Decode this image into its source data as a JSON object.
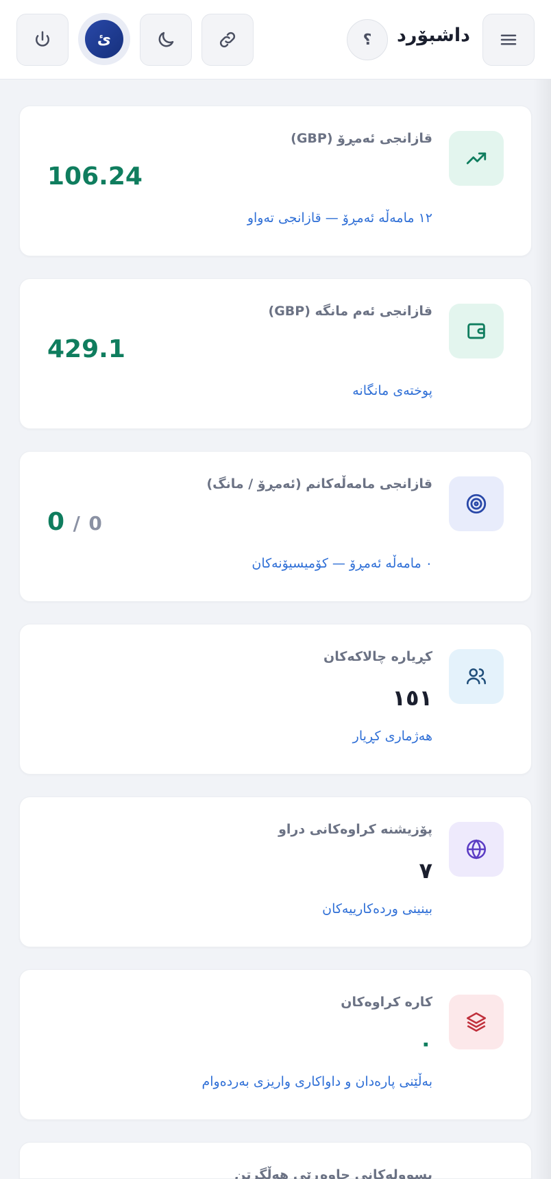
{
  "header": {
    "title": "داشبۆرد",
    "help_label": "؟",
    "avatar_letter": "ئ",
    "icons": [
      "menu-icon",
      "link-icon",
      "moon-icon",
      "power-icon"
    ]
  },
  "cards": [
    {
      "title": "قازانجی ئەمڕۆ (GBP)",
      "value": "106.24",
      "link": "١٢ مامەڵە ئەمڕۆ — قازانجی تەواو",
      "icon": "trending-up-icon",
      "icon_bg": "#e3f5ee",
      "icon_color": "#0f7d5e"
    },
    {
      "title": "قازانجی ئەم مانگە (GBP)",
      "value": "429.1",
      "link": "پوختەی مانگانە",
      "icon": "wallet-icon",
      "icon_bg": "#e3f5ee",
      "icon_color": "#0f7d5e"
    },
    {
      "title": "قازانجی مامەڵەکانم (ئەمڕۆ / مانگ)",
      "value_main": "0",
      "value_sep": "/",
      "value_sub": "0",
      "link": "٠ مامەڵە ئەمڕۆ — کۆمیسیۆنەکان",
      "icon": "target-icon",
      "icon_bg": "#e8ecfb",
      "icon_color": "#2948a8"
    },
    {
      "title": "کڕیارە چالاکەکان",
      "value": "١٥١",
      "link": "هەژماری کڕیار",
      "icon": "users-icon",
      "icon_bg": "#e4f2fb",
      "icon_color": "#1f4e7a"
    },
    {
      "title": "پۆزیشنە کراوەکانی دراو",
      "value": "٧",
      "link": "بینینی وردەکارییەکان",
      "icon": "globe-icon",
      "icon_bg": "#eeeafc",
      "icon_color": "#5b3cc4"
    },
    {
      "title": "کارە کراوەکان",
      "value": "٠",
      "link": "بەڵێنی پارەدان و داواکاری واریزی بەردەوام",
      "icon": "layers-icon",
      "icon_bg": "#fce8ea",
      "icon_color": "#c0303c"
    }
  ],
  "partial_card_title": "پسوولەکانی چاوەڕێی هەڵگرتن"
}
